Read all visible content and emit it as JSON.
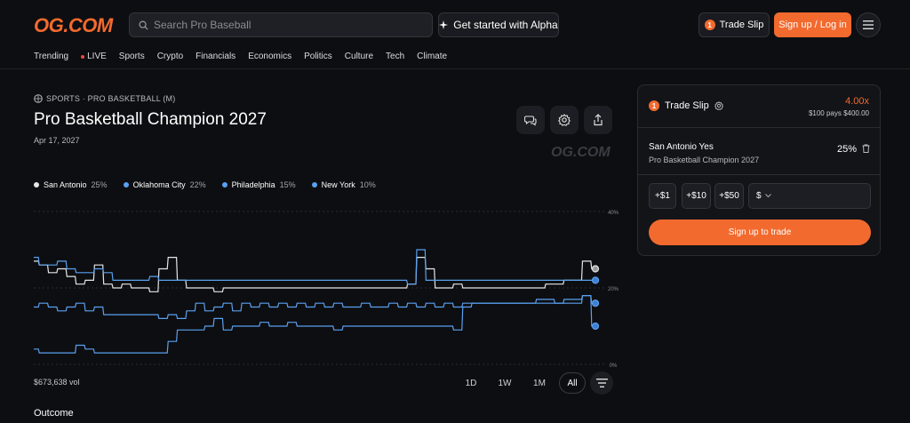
{
  "header": {
    "logo": "OG.COM",
    "search_placeholder": "Search Pro Baseball",
    "alpha_label": "Get started with Alpha",
    "trade_slip_count": "1",
    "trade_slip_label": "Trade Slip",
    "signup_label": "Sign up / Log in"
  },
  "nav": [
    {
      "label": "Trending"
    },
    {
      "label": "LIVE"
    },
    {
      "label": "Sports"
    },
    {
      "label": "Crypto"
    },
    {
      "label": "Financials"
    },
    {
      "label": "Economics"
    },
    {
      "label": "Politics"
    },
    {
      "label": "Culture"
    },
    {
      "label": "Tech"
    },
    {
      "label": "Climate"
    }
  ],
  "market": {
    "breadcrumb": "SPORTS · PRO BASKETBALL (M)",
    "title": "Pro Basketball Champion 2027",
    "date": "Apr 17, 2027",
    "watermark": "OG.COM",
    "volume": "$673,638 vol",
    "outcome_heading": "Outcome"
  },
  "legend": [
    {
      "name": "San Antonio",
      "pct": "25%",
      "color": "#e6e6e6"
    },
    {
      "name": "Oklahoma City",
      "pct": "22%",
      "color": "#5aa0f0"
    },
    {
      "name": "Philadelphia",
      "pct": "15%",
      "color": "#5aa0f0"
    },
    {
      "name": "New York",
      "pct": "10%",
      "color": "#5aa0f0"
    }
  ],
  "ranges": [
    "1D",
    "1W",
    "1M",
    "All"
  ],
  "slip": {
    "count": "1",
    "title": "Trade Slip",
    "multiplier": "4.00x",
    "pays": "$100 pays $400.00",
    "selection": "San Antonio Yes",
    "market": "Pro Basketball Champion 2027",
    "pct": "25%",
    "amounts": [
      "+$1",
      "+$10",
      "+$50"
    ],
    "currency": "$",
    "cta": "Sign up to trade"
  },
  "chart_data": {
    "type": "line",
    "ylim": [
      0,
      40
    ],
    "yticks": [
      "40%",
      "20%",
      "0%"
    ],
    "series": [
      {
        "name": "San Antonio",
        "color": "#e6e6e6",
        "values": [
          27,
          26,
          24,
          25,
          23,
          21,
          22,
          26,
          21,
          20,
          21,
          20,
          20,
          19,
          25,
          28,
          22,
          20,
          20,
          20,
          19,
          20,
          20,
          20,
          20,
          20,
          20,
          20,
          20,
          20,
          20,
          20,
          20,
          20,
          20,
          20,
          20,
          20,
          20,
          20,
          20,
          21,
          28,
          25,
          20,
          20,
          21,
          20,
          20,
          20,
          20,
          20,
          20,
          20,
          20,
          20,
          21,
          21,
          22,
          22,
          27,
          25
        ]
      },
      {
        "name": "Oklahoma City",
        "color": "#5aa0f0",
        "values": [
          28,
          26,
          26,
          27,
          25,
          24,
          24,
          25,
          24,
          22,
          22,
          22,
          22,
          23,
          22,
          22,
          22,
          22,
          22,
          22,
          22,
          22,
          22,
          22,
          22,
          22,
          22,
          22,
          22,
          22,
          22,
          22,
          22,
          22,
          22,
          22,
          22,
          22,
          22,
          22,
          22,
          21,
          30,
          22,
          22,
          22,
          22,
          22,
          22,
          22,
          22,
          22,
          22,
          22,
          22,
          22,
          22,
          22,
          22,
          22,
          22,
          22
        ]
      },
      {
        "name": "Philadelphia",
        "color": "#5aa0f0",
        "values": [
          15,
          16,
          15,
          14,
          15,
          16,
          14,
          15,
          13,
          13,
          13,
          13,
          13,
          13,
          12,
          13,
          12,
          14,
          16,
          14,
          15,
          16,
          14,
          16,
          15,
          16,
          15,
          16,
          15,
          16,
          15,
          16,
          15,
          16,
          15,
          15,
          16,
          15,
          15,
          16,
          15,
          16,
          15,
          16,
          15,
          16,
          15,
          16,
          16,
          16,
          16,
          16,
          16,
          16,
          16,
          17,
          17,
          16,
          17,
          17,
          18,
          16
        ]
      },
      {
        "name": "New York",
        "color": "#5aa0f0",
        "values": [
          4,
          3,
          3,
          3,
          3,
          5,
          4,
          3,
          3,
          3,
          3,
          3,
          3,
          3,
          3,
          6,
          9,
          9,
          9,
          10,
          12,
          9,
          10,
          10,
          10,
          11,
          10,
          10,
          11,
          10,
          10,
          10,
          10,
          9,
          10,
          10,
          10,
          10,
          10,
          10,
          10,
          10,
          10,
          10,
          10,
          10,
          9,
          15,
          16,
          16,
          16,
          16,
          16,
          16,
          16,
          16,
          16,
          16,
          16,
          16,
          18,
          10
        ]
      }
    ]
  }
}
